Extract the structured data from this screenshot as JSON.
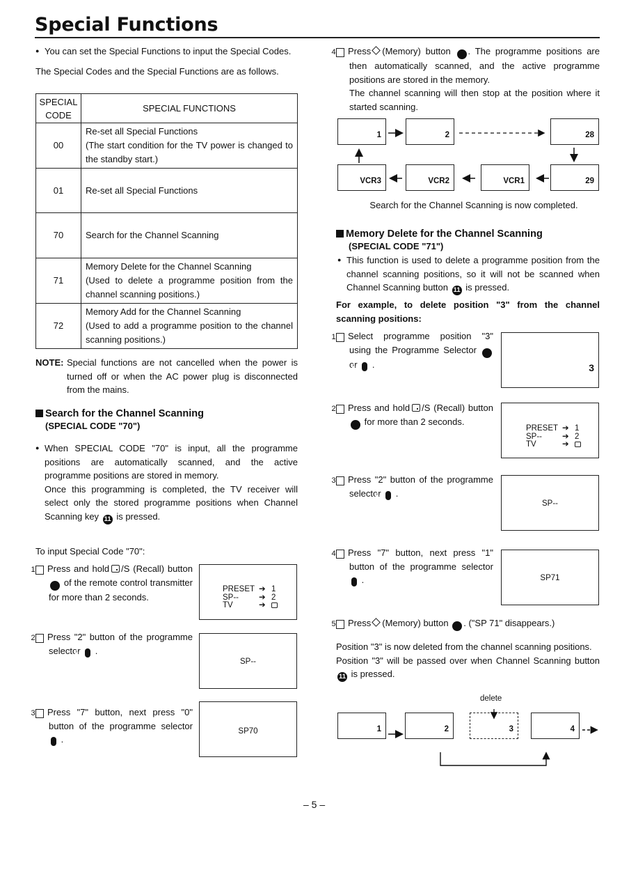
{
  "page": {
    "title": "Special Functions",
    "page_number": "– 5 –"
  },
  "intro": {
    "bullet": "You can set the Special Functions to input the Special Codes.",
    "lead": "The Special Codes and the Special Functions are as follows."
  },
  "table": {
    "headers": [
      "SPECIAL CODE",
      "SPECIAL FUNCTIONS"
    ],
    "rows": [
      {
        "code": "00",
        "function": "Re-set all Special Functions\n(The start condition for the TV power is changed to the standby start.)"
      },
      {
        "code": "01",
        "function": "Re-set all Special Functions"
      },
      {
        "code": "70",
        "function": "Search for the Channel Scanning"
      },
      {
        "code": "71",
        "function": "Memory Delete for the Channel Scanning\n(Used to delete a programme position from the channel scanning positions.)"
      },
      {
        "code": "72",
        "function": "Memory Add for the Channel Scanning\n(Used to add a programme position to the channel scanning positions.)"
      }
    ]
  },
  "note": {
    "label": "NOTE:",
    "text": "Special functions are not cancelled when the power is turned off or when the AC power plug is disconnected from the mains."
  },
  "section70": {
    "heading": "Search for the Channel Scanning",
    "subheading": "(SPECIAL CODE \"70\")",
    "bullet_a": "When SPECIAL CODE \"70\" is input, all the programme positions are automatically scanned, and the active programme positions are stored in memory.",
    "bullet_b_pre": "Once this programming is completed, the TV receiver will select only the stored programme positions when Channel Scanning key",
    "bullet_b_badge": "11",
    "bullet_b_post": "is pressed.",
    "input_label": "To input Special Code \"70\":",
    "steps": [
      {
        "num": "1",
        "pre": "Press and hold",
        "icon_label": "/S (Recall) button",
        "badge": "6",
        "post": "of the remote control transmitter for more than 2 seconds."
      },
      {
        "num": "2",
        "pre": "Press \"2\" button of the programme selector",
        "pill": "2-1",
        "post": "."
      },
      {
        "num": "3",
        "pre": "Press \"7\" button, next press \"0\" button of the programme selector",
        "pill": "2-1",
        "post": "."
      },
      {
        "num": "4",
        "pre": "Press",
        "icon_label": "(Memory) button",
        "badge": "7",
        "post": ". The programme positions are then automatically scanned, and the active programme positions are stored in the memory.",
        "extra": "The channel scanning will then stop at the position where it started scanning."
      }
    ],
    "screens": {
      "menu": [
        {
          "key": "PRESET",
          "value": "1"
        },
        {
          "key": "SP--",
          "value": "2"
        },
        {
          "key": "TV",
          "value": ""
        }
      ],
      "sp_blank": "SP--",
      "sp70": "SP70"
    },
    "flow_top": [
      "1",
      "2",
      "28"
    ],
    "flow_bottom": [
      "VCR3",
      "VCR2",
      "VCR1",
      "29"
    ],
    "caption": "Search for the Channel Scanning is now completed."
  },
  "section71": {
    "heading": "Memory Delete for the Channel Scanning",
    "subheading": "(SPECIAL CODE \"71\")",
    "bullet_pre": "This function is used to delete a programme position from the channel scanning positions, so it will not be scanned when Channel Scanning button",
    "bullet_badge": "11",
    "bullet_post": "is pressed.",
    "example": "For example, to delete position \"3\" from the channel scanning positions:",
    "steps": [
      {
        "num": "1",
        "pre": "Select programme position \"3\" using the Programme Selector",
        "badge": "2",
        "mid": "or",
        "pill": "2-1",
        "post": "."
      },
      {
        "num": "2",
        "pre": "Press and hold",
        "icon_label": "/S (Recall) button",
        "badge": "6",
        "post": "for more than 2 seconds."
      },
      {
        "num": "3",
        "pre": "Press \"2\" button of the programme selector",
        "pill": "2-1",
        "post": "."
      },
      {
        "num": "4",
        "pre": "Press \"7\" button, next press \"1\" button of the programme selector",
        "pill": "2-1",
        "post": "."
      },
      {
        "num": "5",
        "pre": "Press",
        "icon_label": "(Memory) button",
        "badge": "7",
        "post": ". (\"SP 71\" disappears.)"
      }
    ],
    "screens": {
      "pos3": "3",
      "sp_blank": "SP--",
      "sp71": "SP71"
    },
    "result_a": "Position \"3\" is now deleted from the channel scanning positions.",
    "result_b_pre": "Position \"3\" will be passed over when Channel Scanning button",
    "result_b_badge": "11",
    "result_b_post": "is pressed.",
    "delete_label": "delete",
    "flow": [
      "1",
      "2",
      "3",
      "4"
    ]
  }
}
